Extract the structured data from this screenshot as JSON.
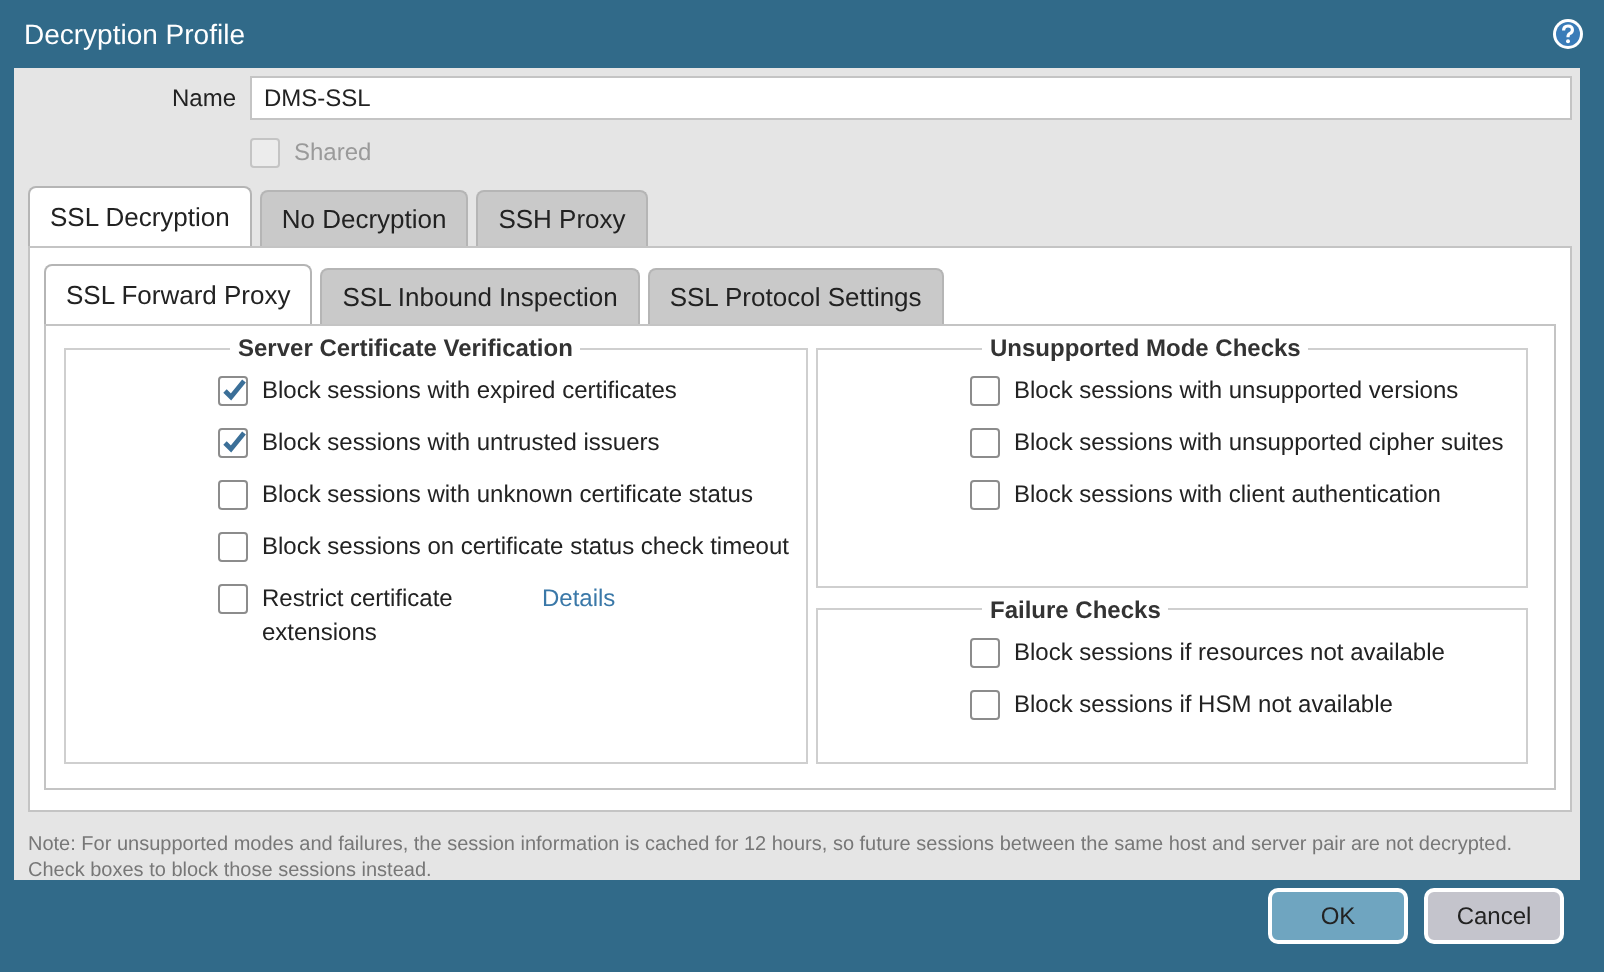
{
  "window": {
    "title": "Decryption Profile"
  },
  "name_field": {
    "label": "Name",
    "value": "DMS-SSL"
  },
  "shared": {
    "label": "Shared",
    "checked": false,
    "disabled": true
  },
  "tabs": [
    {
      "label": "SSL Decryption",
      "selected": true
    },
    {
      "label": "No Decryption",
      "selected": false
    },
    {
      "label": "SSH Proxy",
      "selected": false
    }
  ],
  "subtabs": [
    {
      "label": "SSL Forward Proxy",
      "selected": true
    },
    {
      "label": "SSL Inbound Inspection",
      "selected": false
    },
    {
      "label": "SSL Protocol Settings",
      "selected": false
    }
  ],
  "groups": [
    {
      "title": "Server Certificate Verification",
      "options": [
        {
          "label": "Block sessions with expired certificates",
          "checked": true
        },
        {
          "label": "Block sessions with untrusted issuers",
          "checked": true
        },
        {
          "label": "Block sessions with unknown certificate status",
          "checked": false
        },
        {
          "label": "Block sessions on certificate status check timeout",
          "checked": false
        },
        {
          "label": "Restrict certificate extensions",
          "checked": false,
          "link": "Details"
        }
      ]
    },
    {
      "title": "Unsupported Mode Checks",
      "options": [
        {
          "label": "Block sessions with unsupported versions",
          "checked": false
        },
        {
          "label": "Block sessions with unsupported cipher suites",
          "checked": false
        },
        {
          "label": "Block sessions with client authentication",
          "checked": false
        }
      ]
    },
    {
      "title": "Failure Checks",
      "options": [
        {
          "label": "Block sessions if resources not available",
          "checked": false
        },
        {
          "label": "Block sessions if HSM not available",
          "checked": false
        }
      ]
    }
  ],
  "note": "Note: For unsupported modes and failures, the session information is cached for 12 hours, so future sessions between the same host and server pair are not decrypted. Check boxes to block those sessions instead.",
  "buttons": [
    {
      "label": "OK",
      "kind": "primary"
    },
    {
      "label": "Cancel",
      "kind": "secondary"
    }
  ]
}
